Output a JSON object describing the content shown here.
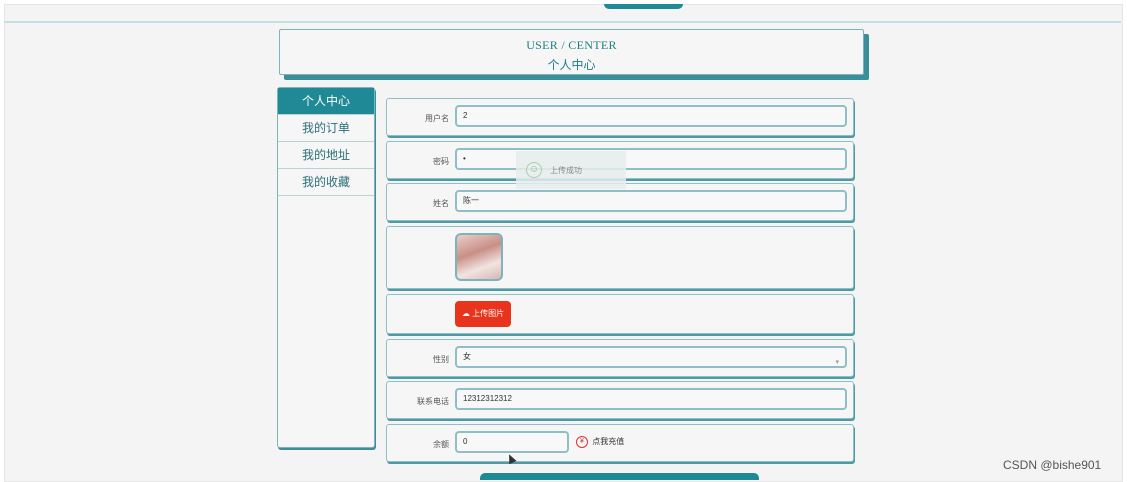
{
  "header": {
    "title_en": "USER / CENTER",
    "title_cn": "个人中心"
  },
  "sidebar": {
    "items": [
      {
        "label": "个人中心",
        "active": true
      },
      {
        "label": "我的订单",
        "active": false
      },
      {
        "label": "我的地址",
        "active": false
      },
      {
        "label": "我的收藏",
        "active": false
      }
    ]
  },
  "form": {
    "username": {
      "label": "用户名",
      "value": "2"
    },
    "password": {
      "label": "密码",
      "value": "•"
    },
    "name": {
      "label": "姓名",
      "value": "陈一"
    },
    "upload_button": "上传图片",
    "gender": {
      "label": "性别",
      "value": "女"
    },
    "phone": {
      "label": "联系电话",
      "value": "12312312312"
    },
    "balance": {
      "label": "余额",
      "value": "0"
    },
    "recharge_link": "点我充值"
  },
  "toast": {
    "text": "上传成功"
  },
  "watermark": "CSDN @bishe901",
  "colors": {
    "accent": "#1f8a95",
    "upload": "#e8341c"
  }
}
